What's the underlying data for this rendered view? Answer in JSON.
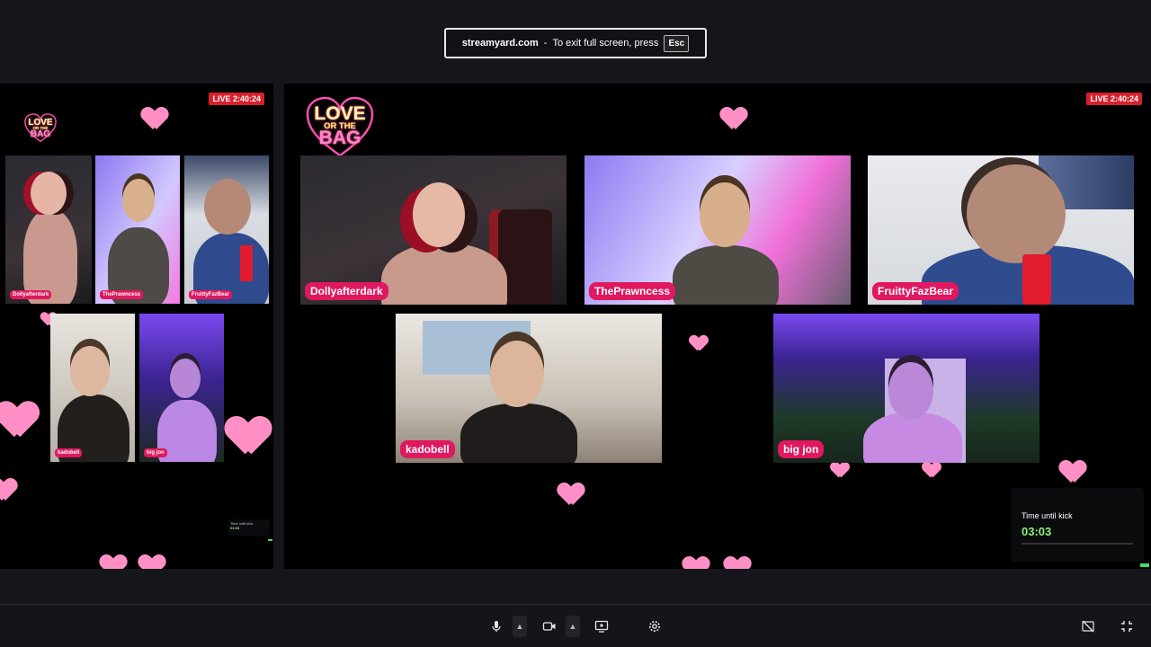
{
  "fullscreen_notice": {
    "domain": "streamyard.com",
    "separator": "-",
    "message": "To exit full screen, press",
    "key": "Esc"
  },
  "preview": {
    "live_badge": "LIVE 2:40:24",
    "logo": {
      "line1": "LOVE",
      "line2": "OR THE",
      "line3": "BAG"
    },
    "participants": [
      "Dollyafterdark",
      "ThePrawncess",
      "FruittyFazBear",
      "kadobell",
      "big jon"
    ],
    "timer_label": "Time until kick",
    "timer_value": "03:03"
  },
  "main": {
    "live_badge": "LIVE 2:40:24",
    "logo": {
      "line1": "LOVE",
      "line2": "OR THE",
      "line3": "BAG"
    },
    "participants": [
      {
        "name": "Dollyafterdark"
      },
      {
        "name": "ThePrawncess"
      },
      {
        "name": "FruittyFazBear"
      },
      {
        "name": "kadobell"
      },
      {
        "name": "big jon"
      }
    ],
    "timer": {
      "label": "Time until kick",
      "value": "03:03"
    }
  },
  "toolbar": {
    "icons": [
      "microphone-icon",
      "chevron-up-icon",
      "camera-icon",
      "chevron-up-icon",
      "screen-share-icon",
      "settings-icon",
      "hide-video-icon",
      "exit-fullscreen-icon"
    ]
  },
  "colors": {
    "background": "#15161b",
    "stage": "#000000",
    "name_tag": "#e0185f",
    "live_badge": "#d8202c",
    "timer_value": "#8ef07d",
    "heart": "#ff8fc4"
  }
}
